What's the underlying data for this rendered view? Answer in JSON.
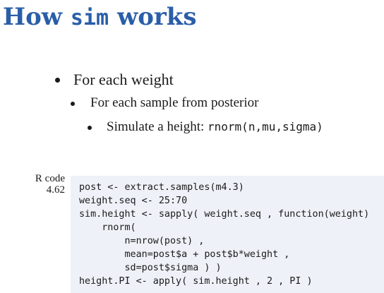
{
  "slide": {
    "title_prefix": "How ",
    "title_code": "sim",
    "title_suffix": " works"
  },
  "bullets": {
    "level1": "For each weight",
    "level2": "For each sample from posterior",
    "level3_text": "Simulate a height: ",
    "level3_code": "rnorm(n,mu,sigma)"
  },
  "code_block": {
    "label_line1": "R code",
    "label_line2": "4.62",
    "lines": [
      "post <- extract.samples(m4.3)",
      "weight.seq <- 25:70",
      "sim.height <- sapply( weight.seq , function(weight)",
      "    rnorm(",
      "        n=nrow(post) ,",
      "        mean=post$a + post$b*weight ,",
      "        sd=post$sigma ) )",
      "height.PI <- apply( sim.height , 2 , PI )"
    ]
  }
}
